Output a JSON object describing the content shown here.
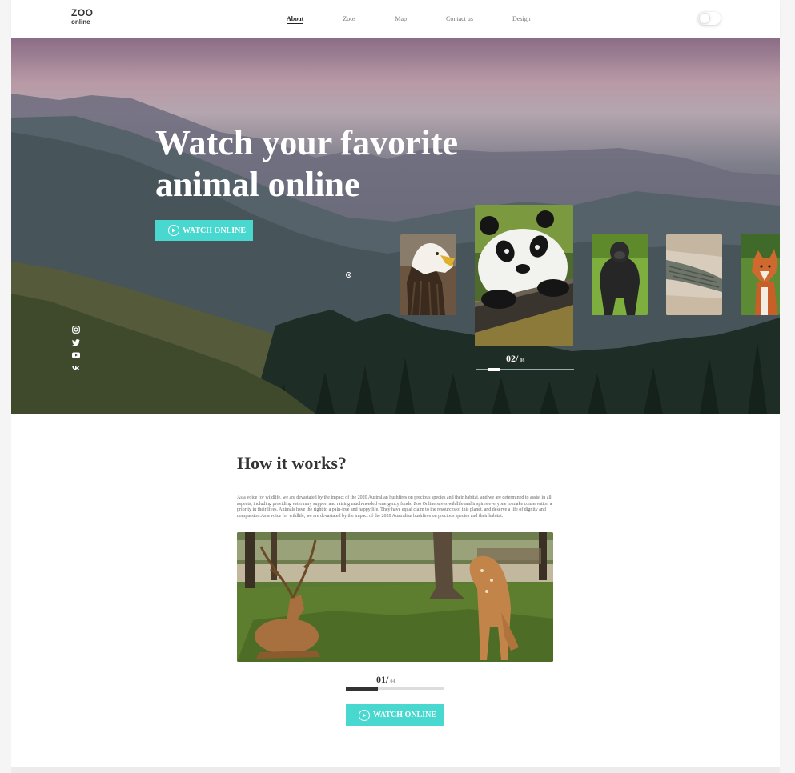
{
  "logo": {
    "line1": "ZOO",
    "line2": "online"
  },
  "nav": [
    {
      "label": "About",
      "active": true
    },
    {
      "label": "Zoos",
      "active": false
    },
    {
      "label": "Map",
      "active": false
    },
    {
      "label": "Contact us",
      "active": false
    },
    {
      "label": "Design",
      "active": false
    }
  ],
  "theme_toggle": {
    "on": false
  },
  "hero": {
    "title_line1": "Watch your favorite",
    "title_line2": "animal online",
    "button_label": "WATCH ONLINE",
    "social": [
      "instagram-icon",
      "twitter-icon",
      "youtube-icon",
      "vk-icon"
    ],
    "animals": [
      "eagle",
      "panda",
      "gorilla",
      "crocodile",
      "fox"
    ],
    "active_animal": "panda",
    "counter_current": "02/",
    "counter_total": "08",
    "progress": 0.125
  },
  "how": {
    "title": "How it works?",
    "text": "As a voice for wildlife, we are devastated by the impact of the 2020 Australian bushfires on precious species and their habitat, and we are determined to assist in all aspects, including providing veterinary support and raising much-needed emergency funds. Zoo Online saves wildlife and inspires everyone to make conservation a priority in their lives. Animals have the right to a pain-free and happy life. They have equal claim to the resources of this planet, and deserve a life of dignity and compassion.As a voice for wildlife, we are devastated by the impact of the 2020 Australian bushfires on precious species and their habitat.",
    "counter_current": "01/",
    "counter_total": "04",
    "progress": 0.25,
    "button_label": "WATCH ONLINE"
  },
  "colors": {
    "accent": "#48d8cf",
    "text_dark": "#333333"
  }
}
